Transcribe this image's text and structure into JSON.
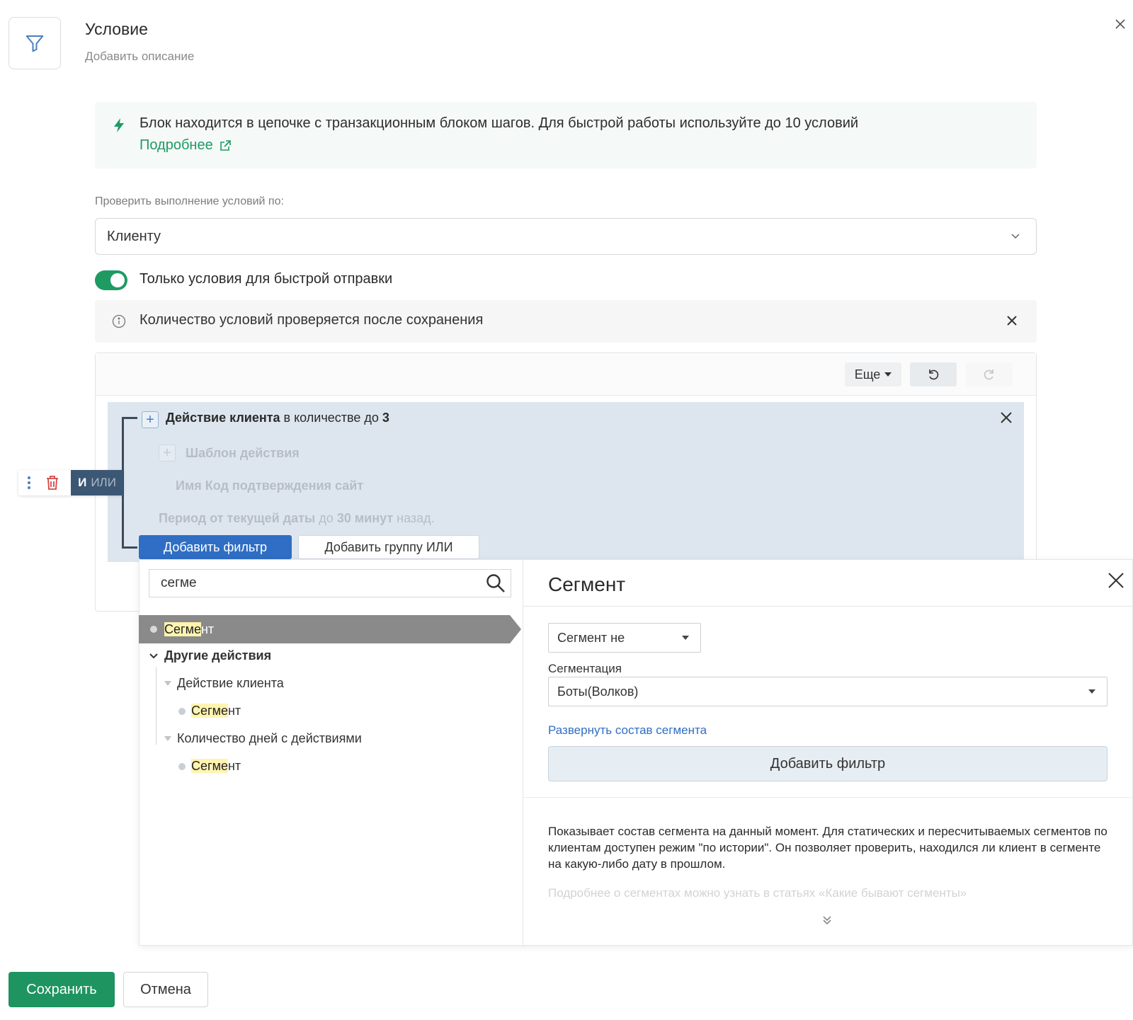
{
  "header": {
    "title": "Условие",
    "subtitle": "Добавить описание"
  },
  "banner": {
    "text": "Блок находится в цепочке с транзакционным блоком шагов. Для быстрой работы используйте до 10 условий",
    "link": "Подробнее"
  },
  "check_by": {
    "label": "Проверить выполнение условий по:",
    "value": "Клиенту"
  },
  "fast_send": {
    "enabled": true,
    "label": "Только условия для быстрой отправки"
  },
  "notice": {
    "text": "Количество условий проверяется после сохранения"
  },
  "toolbar": {
    "more": "Еще"
  },
  "condition": {
    "title_bold": "Действие клиента",
    "title_rest": " в количестве до ",
    "count": "3",
    "template_label": "Шаблон действия",
    "name_label": "Имя Код подтверждения сайт",
    "period_a": "Период от текущей даты",
    "period_b": " до ",
    "period_c": "30 минут",
    "period_d": " назад."
  },
  "group_tools": {
    "and": "И",
    "or": "ИЛИ"
  },
  "buttons": {
    "add_filter": "Добавить фильтр",
    "add_or_group": "Добавить группу ИЛИ",
    "save": "Сохранить",
    "cancel": "Отмена"
  },
  "search": {
    "value": "сегме"
  },
  "tree": {
    "selected_hl": "Сегме",
    "selected_rest": "нт",
    "other_actions": "Другие действия",
    "client_action": "Действие клиента",
    "seg1_hl": "Сегме",
    "seg1_rest": "нт",
    "days_with_actions": "Количество дней с действиями",
    "seg2_hl": "Сегме",
    "seg2_rest": "нт"
  },
  "detail": {
    "title": "Сегмент",
    "operator": "Сегмент не",
    "segmentation_label": "Сегментация",
    "segmentation_value": "Боты(Волков)",
    "expand_link": "Развернуть состав сегмента",
    "add_filter": "Добавить фильтр",
    "description": "Показывает состав сегмента на данный момент. Для статических и пересчитываемых сегментов по клиентам доступен режим \"по истории\". Он позволяет проверить, находился ли клиент в сегменте на какую-либо дату в прошлом.",
    "description_faded": "Подробнее о сегментах можно узнать в статьях «Какие бывают сегменты»"
  },
  "colors": {
    "accent_green": "#1e9461",
    "accent_blue": "#2f6ec4",
    "group_bg": "#dde6ef"
  }
}
